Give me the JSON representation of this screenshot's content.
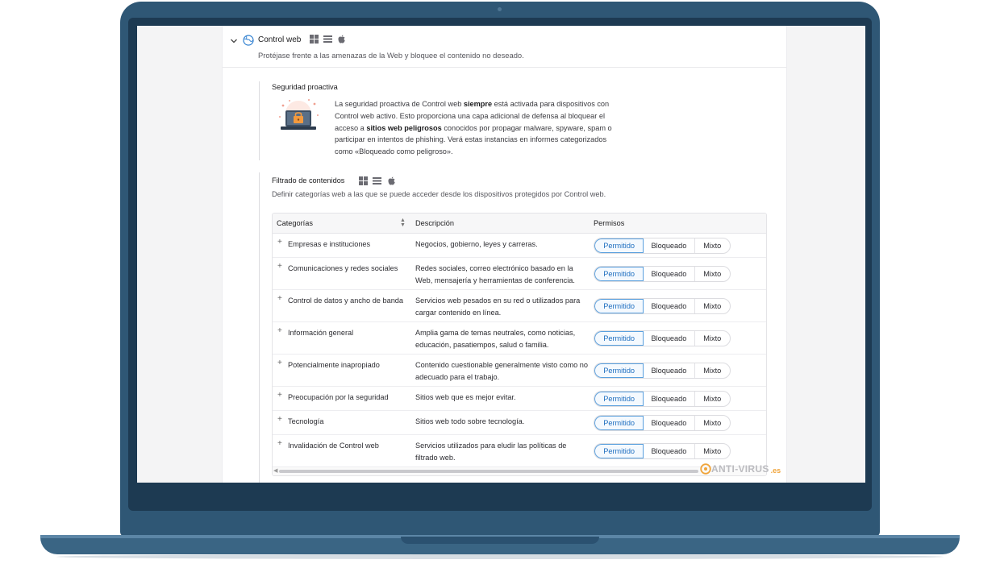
{
  "header": {
    "title": "Control web",
    "subtitle": "Protéjase frente a las amenazas de la Web y bloquee el contenido no deseado."
  },
  "proactive": {
    "title": "Seguridad proactiva",
    "text_1": "La seguridad proactiva de Control web ",
    "text_bold_1": "siempre",
    "text_2": " está activada para dispositivos con Control web activo. Esto proporciona una capa adicional de defensa al bloquear el acceso a ",
    "text_bold_2": "sitios web peligrosos",
    "text_3": " conocidos por propagar malware, spyware, spam o participar en intentos de phishing. Verá estas instancias en informes categorizados como «Bloqueado como peligroso»."
  },
  "filtering": {
    "title": "Filtrado de contenidos",
    "subtitle": "Definir categorías web a las que se puede acceder desde los dispositivos protegidos por Control web."
  },
  "table": {
    "headers": {
      "category": "Categorías",
      "description": "Descripción",
      "permissions": "Permisos"
    },
    "segment_labels": {
      "allowed": "Permitido",
      "blocked": "Bloqueado",
      "mixed": "Mixto"
    },
    "rows": [
      {
        "category": "Empresas e instituciones",
        "description": "Negocios, gobierno, leyes y carreras.",
        "selected": "Permitido"
      },
      {
        "category": "Comunicaciones y redes sociales",
        "description": "Redes sociales, correo electrónico basado en la Web, mensajería y herramientas de conferencia.",
        "selected": "Permitido"
      },
      {
        "category": "Control de datos y ancho de banda",
        "description": "Servicios web pesados en su red o utilizados para cargar contenido en línea.",
        "selected": "Permitido"
      },
      {
        "category": "Información general",
        "description": "Amplia gama de temas neutrales, como noticias, educación, pasatiempos, salud o familia.",
        "selected": "Permitido"
      },
      {
        "category": "Potencialmente inapropiado",
        "description": "Contenido cuestionable generalmente visto como no adecuado para el trabajo.",
        "selected": "Permitido"
      },
      {
        "category": "Preocupación por la seguridad",
        "description": "Sitios web que es mejor evitar.",
        "selected": "Permitido"
      },
      {
        "category": "Tecnología",
        "description": "Sitios web todo sobre tecnología.",
        "selected": "Permitido"
      },
      {
        "category": "Invalidación de Control web",
        "description": "Servicios utilizados para eludir las políticas de filtrado web.",
        "selected": "Permitido"
      }
    ]
  },
  "watermark": {
    "text": "ANTI-VIRUS",
    "suffix": ".es"
  },
  "icons": {
    "collapse": "chevron-down-icon",
    "module": "globe-icon",
    "os": [
      "windows-icon",
      "list-icon",
      "apple-icon"
    ],
    "row_expand": "plus-icon",
    "sort": "sort-icon"
  },
  "colors": {
    "accent": "#1f6fc0",
    "accent_border": "#5aa0de",
    "laptop": "#2f5775"
  }
}
